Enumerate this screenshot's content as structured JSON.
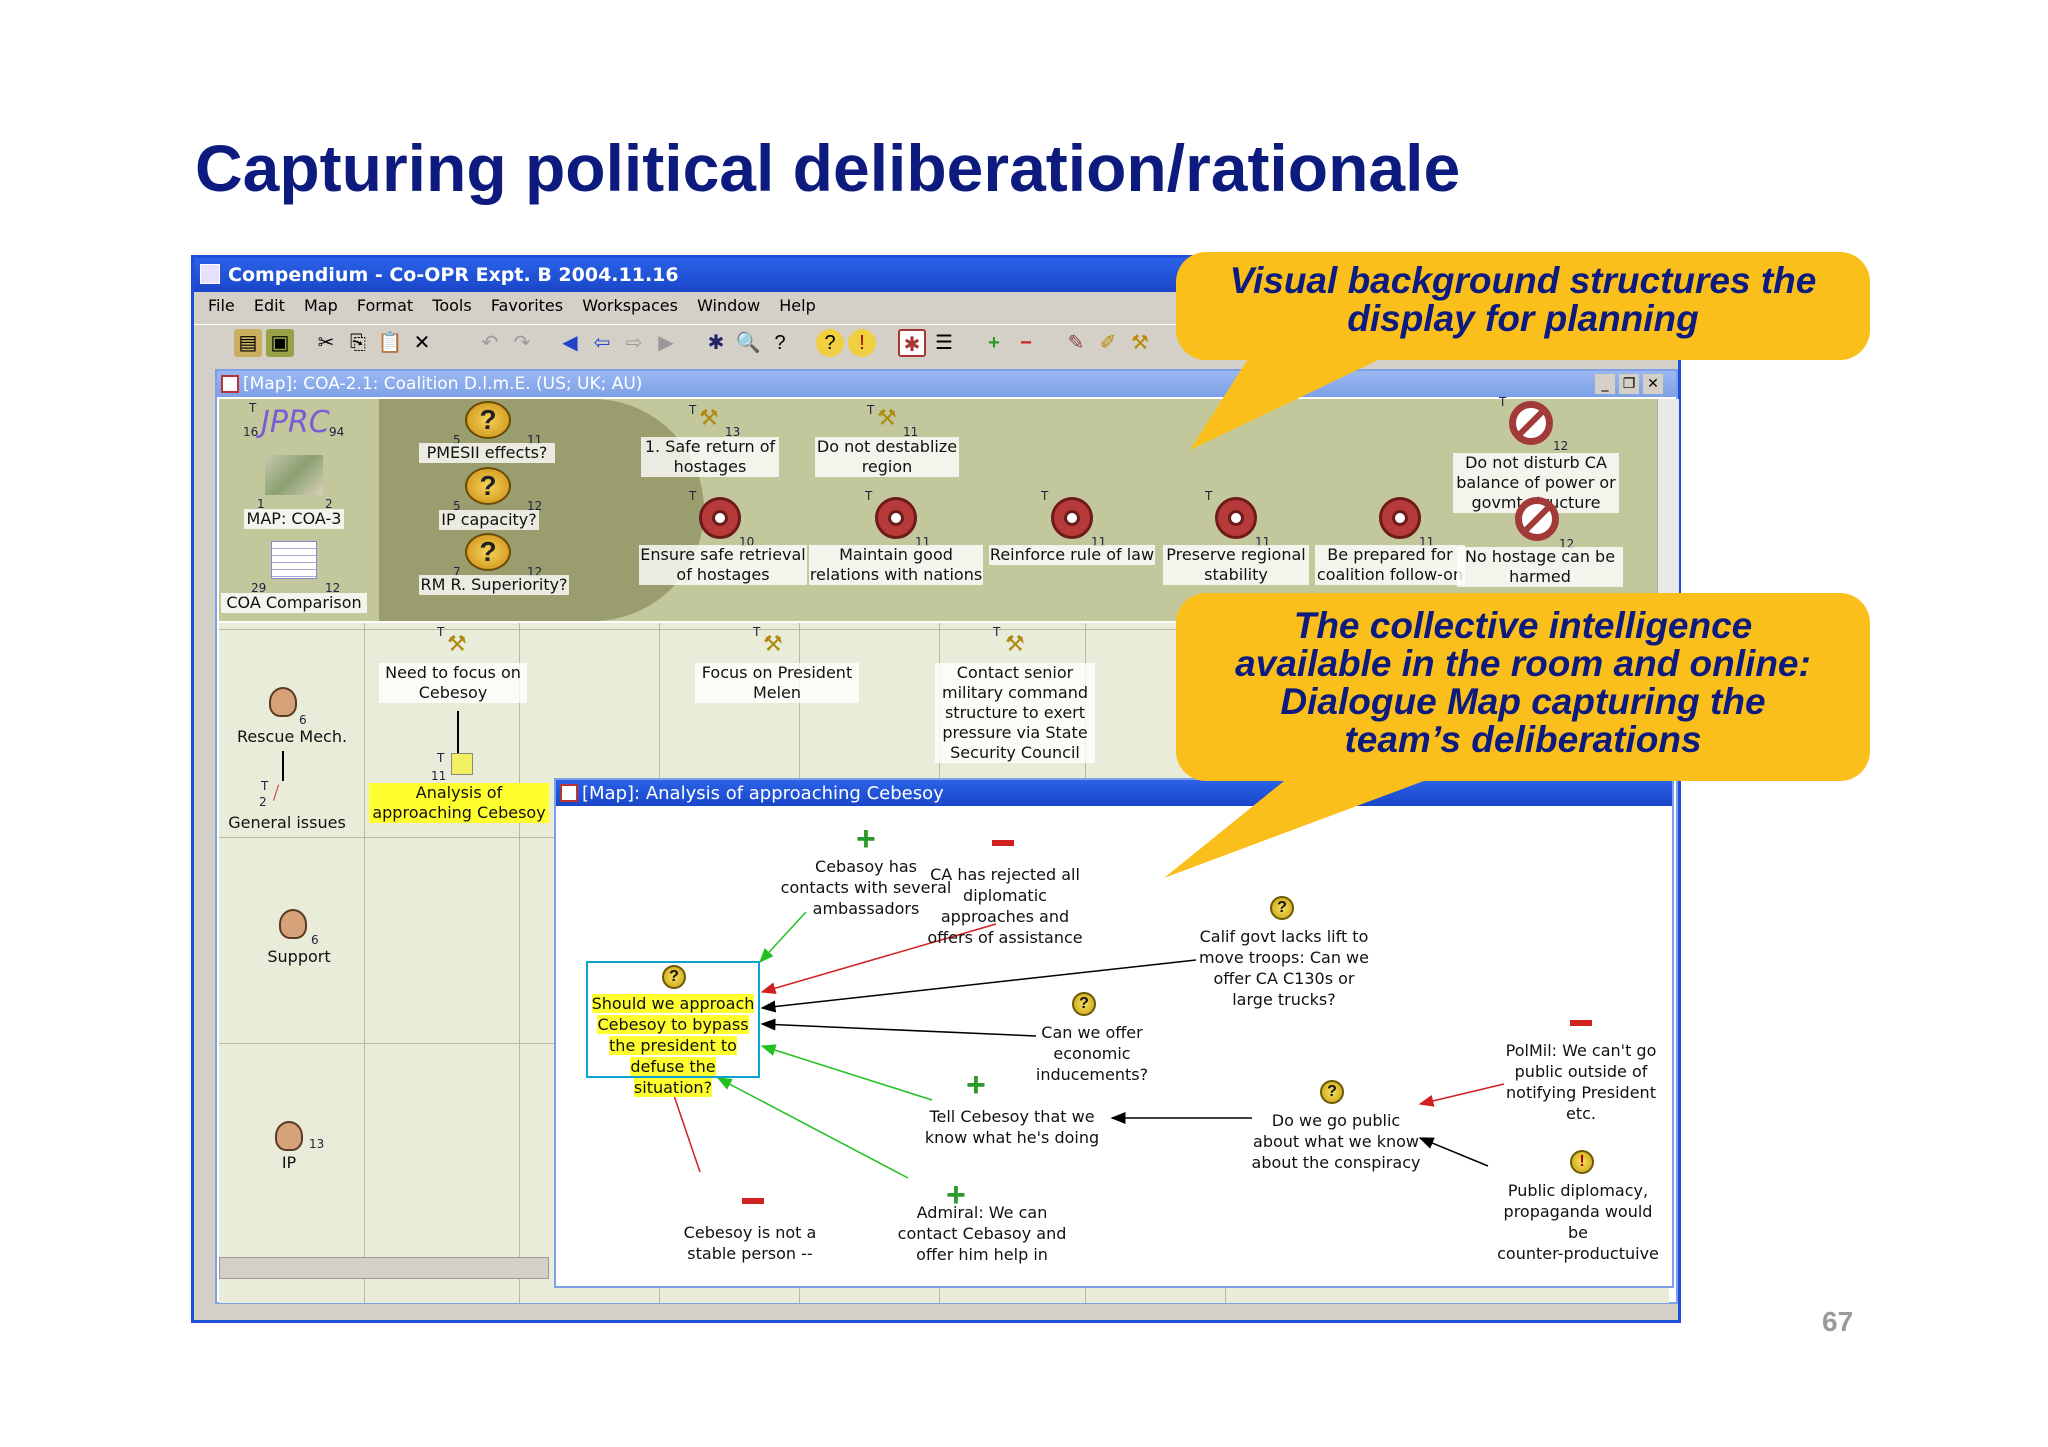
{
  "slide": {
    "title": "Capturing political deliberation/rationale",
    "page_number": "67"
  },
  "app": {
    "title": "Compendium - Co-OPR Expt. B 2004.11.16",
    "menu": [
      "File",
      "Edit",
      "Map",
      "Format",
      "Tools",
      "Favorites",
      "Workspaces",
      "Window",
      "Help"
    ]
  },
  "map1": {
    "title": "[Map]: COA-2.1: Coalition D.l.m.E. (US; UK; AU)",
    "left_nodes": {
      "jprc": {
        "label": "JPRC",
        "n1": "16",
        "n2": "94",
        "t": "T"
      },
      "map_coa3": {
        "label": "MAP: COA-3",
        "n1": "1",
        "n2": "2"
      },
      "coa_comparison": {
        "label": "COA Comparison",
        "n1": "29",
        "n2": "12"
      }
    },
    "question_nodes": [
      {
        "label": "PMESII  effects?",
        "n1": "5",
        "n2": "11"
      },
      {
        "label": "IP capacity?",
        "n1": "5",
        "n2": "12"
      },
      {
        "label": "RM R. Superiority?",
        "n1": "7",
        "n2": "12"
      }
    ],
    "top_decisions": [
      {
        "label_l1": "1. Safe return of",
        "label_l2": "hostages",
        "n": "13",
        "t": "T"
      },
      {
        "label_l1": "Do not destablize",
        "label_l2": "region",
        "n": "11",
        "t": "T"
      }
    ],
    "target_nodes": [
      {
        "label_l1": "Ensure safe retrieval",
        "label_l2": "of hostages",
        "n": "10",
        "t": "T"
      },
      {
        "label_l1": "Maintain good",
        "label_l2": "relations with nations",
        "n": "11",
        "t": "T"
      },
      {
        "label_l1": "Reinforce rule of law",
        "label_l2": "",
        "n": "11",
        "t": "T"
      },
      {
        "label_l1": "Preserve regional",
        "label_l2": "stability",
        "n": "11",
        "t": "T"
      },
      {
        "label_l1": "Be prepared for",
        "label_l2": "coalition follow-on",
        "n": "11",
        "t": ""
      }
    ],
    "no_nodes": [
      {
        "label_l1": "Do not disturb CA",
        "label_l2": "balance of power or",
        "label_l3": "govmt structure",
        "n": "12",
        "t": "T"
      },
      {
        "label_l1": "No hostage can be",
        "label_l2": "harmed",
        "n": "12",
        "t": ""
      }
    ],
    "lanes": [
      {
        "label": "Rescue Mech.",
        "n": "6"
      },
      {
        "label": "General issues",
        "n": "2",
        "t": "T"
      },
      {
        "label": "Support",
        "n": "6"
      },
      {
        "label": "IP",
        "n": "13"
      }
    ],
    "grid_nodes": [
      {
        "label_l1": "Need to focus on",
        "label_l2": "Cebesoy",
        "t": "T"
      },
      {
        "label_l1": "Focus on President",
        "label_l2": "Melen",
        "t": "T"
      },
      {
        "label_l1": "Contact senior",
        "label_l2": "military command",
        "label_l3": "structure to exert",
        "label_l4": "pressure via State",
        "label_l5": "Security Council",
        "t": "T"
      }
    ],
    "analysis_node": {
      "label_l1": "Analysis of",
      "label_l2": "approaching Cebesoy",
      "n": "11",
      "t": "T"
    }
  },
  "map2": {
    "title": "[Map]: Analysis of approaching Cebesoy",
    "nodes": {
      "focus": [
        "Should we approach",
        "Cebesoy to bypass",
        "the president to",
        "defuse the situation?"
      ],
      "contacts": [
        "Cebasoy has",
        "contacts with several",
        "ambassadors"
      ],
      "rejected": [
        "CA has rejected all",
        "diplomatic",
        "approaches and",
        "offers of assistance"
      ],
      "calif": [
        "Calif govt lacks lift to",
        "move troops: Can we",
        "offer CA C130s or",
        "large trucks?"
      ],
      "economic": [
        "Can we offer",
        "economic",
        "inducements?"
      ],
      "tell": [
        "Tell Cebesoy that we",
        "know what he's doing"
      ],
      "public": [
        "Do we go public",
        "about what we know",
        "about the conspiracy"
      ],
      "polmil": [
        "PolMil: We can't go",
        "public outside of",
        "notifying President",
        "etc."
      ],
      "diplomacy": [
        "Public diplomacy,",
        "propaganda would",
        "be",
        "counter-productuive"
      ],
      "unstable": [
        "Cebesoy is not a",
        "stable person --"
      ],
      "admiral": [
        "Admiral: We can",
        "contact Cebasoy and",
        "offer him help in"
      ]
    }
  },
  "callouts": {
    "c1": [
      "Visual background structures the",
      "display for planning"
    ],
    "c2": [
      "The collective intelligence",
      "available in the room and online:",
      "Dialogue Map capturing the",
      "team’s deliberations"
    ]
  },
  "colors": {
    "title": "#0d1b7e",
    "callout_bg": "#fbbf1b",
    "titlebar": "#1a46c8",
    "pro": "#2a9a2a",
    "con": "#d02020"
  }
}
